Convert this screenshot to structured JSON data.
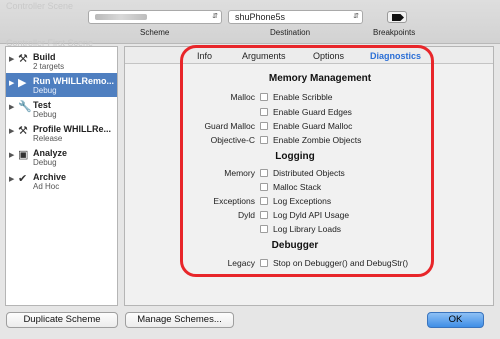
{
  "toolbar": {
    "ghost_top": "Controller Scene",
    "ghost_mid": "Controller First Scene",
    "scheme_label": "Scheme",
    "destination_value": "shuPhone5s",
    "destination_label": "Destination",
    "breakpoints_label": "Breakpoints"
  },
  "sidebar": {
    "items": [
      {
        "name": "Build",
        "sub": "2 targets",
        "icon": "hammer-icon"
      },
      {
        "name": "Run WHILLRemo...",
        "sub": "Debug",
        "icon": "play-icon"
      },
      {
        "name": "Test",
        "sub": "Debug",
        "icon": "wrench-icon"
      },
      {
        "name": "Profile WHILLRe...",
        "sub": "Release",
        "icon": "tools-icon"
      },
      {
        "name": "Analyze",
        "sub": "Debug",
        "icon": "analyze-icon"
      },
      {
        "name": "Archive",
        "sub": "Ad Hoc",
        "icon": "archive-icon"
      }
    ]
  },
  "tabs": [
    "Info",
    "Arguments",
    "Options",
    "Diagnostics"
  ],
  "active_tab": "Diagnostics",
  "diagnostics": {
    "memory_management_title": "Memory Management",
    "malloc_label": "Malloc",
    "enable_scribble": "Enable Scribble",
    "enable_guard_edges": "Enable Guard Edges",
    "guard_malloc_label": "Guard Malloc",
    "enable_guard_malloc": "Enable Guard Malloc",
    "objective_c_label": "Objective-C",
    "enable_zombie_objects": "Enable Zombie Objects",
    "logging_title": "Logging",
    "memory_label": "Memory",
    "distributed_objects": "Distributed Objects",
    "malloc_stack": "Malloc Stack",
    "exceptions_label": "Exceptions",
    "log_exceptions": "Log Exceptions",
    "dyld_label": "Dyld",
    "log_dyld_api_usage": "Log Dyld API Usage",
    "log_library_loads": "Log Library Loads",
    "debugger_title": "Debugger",
    "legacy_label": "Legacy",
    "stop_on_debugger": "Stop on Debugger() and DebugStr()"
  },
  "buttons": {
    "duplicate_scheme": "Duplicate Scheme",
    "manage_schemes": "Manage Schemes...",
    "ok": "OK"
  },
  "colors": {
    "accent": "#2b6fd6",
    "selection": "#4f7fc0",
    "highlight": "#e8262a"
  }
}
